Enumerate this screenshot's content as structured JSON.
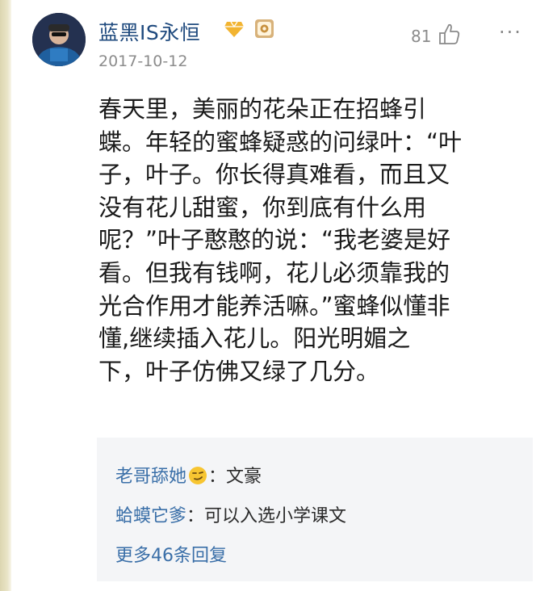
{
  "post": {
    "author": "蓝黑IS永恒",
    "date": "2017-10-12",
    "like_count": "81",
    "icons": {
      "vip": "diamond-vip-icon",
      "badge": "gold-badge-icon",
      "like": "thumbs-up-icon",
      "more": "ellipsis-icon"
    },
    "content_lines": [
      "春天里，美丽的花朵正在招蜂引",
      "蝶。年轻的蜜蜂疑惑的问绿叶：“叶",
      "子，叶子。你长得真难看，而且又",
      "没有花儿甜蜜，你到底有什么用",
      "呢？”叶子憨憨的说：“我老婆是好",
      "看。但我有钱啊，花儿必须靠我的",
      "光合作用才能养活嘛。”蜜蜂似懂非",
      "懂,继续插入花儿。阳光明媚之",
      "下，叶子仿佛又绿了几分。"
    ]
  },
  "comments": [
    {
      "author": "老哥舔她",
      "has_emoji": true,
      "sep": "：",
      "text": "文豪"
    },
    {
      "author": "蛤蟆它爹",
      "has_emoji": false,
      "sep": "：",
      "text": "可以入选小学课文"
    }
  ],
  "more_replies": "更多46条回复",
  "colors": {
    "link_blue": "#3a6fa8",
    "username_blue": "#1f4a7e",
    "meta_gray": "#8c8c8c",
    "comment_bg": "#f4f5f7"
  }
}
